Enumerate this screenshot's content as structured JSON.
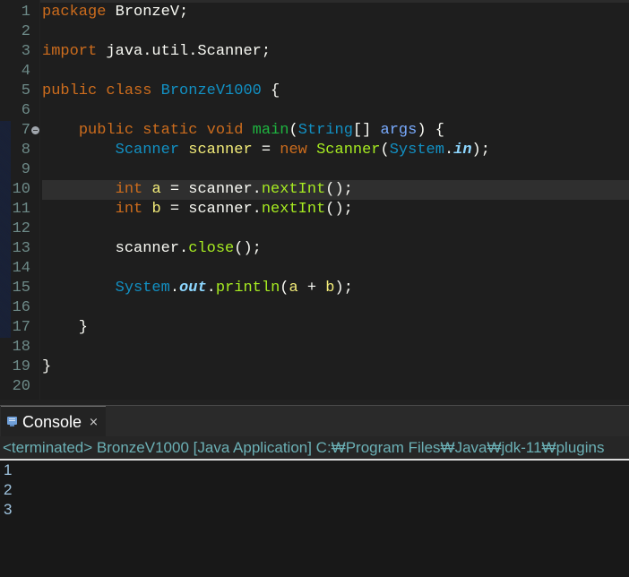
{
  "editor": {
    "current_line": 10,
    "lines": [
      {
        "n": "1",
        "tokens": [
          {
            "t": "package",
            "c": "kw"
          },
          {
            "t": " BronzeV;",
            "c": "punc"
          }
        ]
      },
      {
        "n": "2",
        "tokens": []
      },
      {
        "n": "3",
        "tokens": [
          {
            "t": "import",
            "c": "kw"
          },
          {
            "t": " java.util.Scanner;",
            "c": "punc"
          }
        ]
      },
      {
        "n": "4",
        "tokens": []
      },
      {
        "n": "5",
        "tokens": [
          {
            "t": "public",
            "c": "kw"
          },
          {
            "t": " ",
            "c": "punc"
          },
          {
            "t": "class",
            "c": "kw"
          },
          {
            "t": " ",
            "c": "punc"
          },
          {
            "t": "BronzeV1000",
            "c": "cls"
          },
          {
            "t": " {",
            "c": "punc"
          }
        ]
      },
      {
        "n": "6",
        "tokens": []
      },
      {
        "n": "7",
        "fold": true,
        "tokens": [
          {
            "t": "    ",
            "c": "punc"
          },
          {
            "t": "public",
            "c": "kw"
          },
          {
            "t": " ",
            "c": "punc"
          },
          {
            "t": "static",
            "c": "kw"
          },
          {
            "t": " ",
            "c": "punc"
          },
          {
            "t": "void",
            "c": "kw"
          },
          {
            "t": " ",
            "c": "punc"
          },
          {
            "t": "main",
            "c": "mdecl"
          },
          {
            "t": "(",
            "c": "punc"
          },
          {
            "t": "String",
            "c": "cls"
          },
          {
            "t": "[] ",
            "c": "punc"
          },
          {
            "t": "args",
            "c": "param"
          },
          {
            "t": ") {",
            "c": "punc"
          }
        ]
      },
      {
        "n": "8",
        "tokens": [
          {
            "t": "        ",
            "c": "punc"
          },
          {
            "t": "Scanner",
            "c": "cls"
          },
          {
            "t": " ",
            "c": "punc"
          },
          {
            "t": "scanner",
            "c": "var"
          },
          {
            "t": " = ",
            "c": "punc"
          },
          {
            "t": "new",
            "c": "kw"
          },
          {
            "t": " ",
            "c": "punc"
          },
          {
            "t": "Scanner",
            "c": "mcall"
          },
          {
            "t": "(",
            "c": "punc"
          },
          {
            "t": "System",
            "c": "cls"
          },
          {
            "t": ".",
            "c": "punc"
          },
          {
            "t": "in",
            "c": "static"
          },
          {
            "t": ");",
            "c": "punc"
          }
        ]
      },
      {
        "n": "9",
        "tokens": []
      },
      {
        "n": "10",
        "tokens": [
          {
            "t": "        ",
            "c": "punc"
          },
          {
            "t": "int",
            "c": "kw"
          },
          {
            "t": " ",
            "c": "punc"
          },
          {
            "t": "a",
            "c": "var"
          },
          {
            "t": " = scanner.",
            "c": "punc"
          },
          {
            "t": "nextInt",
            "c": "mcall"
          },
          {
            "t": "();",
            "c": "punc"
          }
        ]
      },
      {
        "n": "11",
        "tokens": [
          {
            "t": "        ",
            "c": "punc"
          },
          {
            "t": "int",
            "c": "kw"
          },
          {
            "t": " ",
            "c": "punc"
          },
          {
            "t": "b",
            "c": "var"
          },
          {
            "t": " = scanner.",
            "c": "punc"
          },
          {
            "t": "nextInt",
            "c": "mcall"
          },
          {
            "t": "();",
            "c": "punc"
          }
        ]
      },
      {
        "n": "12",
        "tokens": []
      },
      {
        "n": "13",
        "tokens": [
          {
            "t": "        scanner.",
            "c": "punc"
          },
          {
            "t": "close",
            "c": "mcall"
          },
          {
            "t": "();",
            "c": "punc"
          }
        ]
      },
      {
        "n": "14",
        "tokens": []
      },
      {
        "n": "15",
        "tokens": [
          {
            "t": "        ",
            "c": "punc"
          },
          {
            "t": "System",
            "c": "cls"
          },
          {
            "t": ".",
            "c": "punc"
          },
          {
            "t": "out",
            "c": "static"
          },
          {
            "t": ".",
            "c": "punc"
          },
          {
            "t": "println",
            "c": "mcall"
          },
          {
            "t": "(",
            "c": "punc"
          },
          {
            "t": "a",
            "c": "var"
          },
          {
            "t": " + ",
            "c": "punc"
          },
          {
            "t": "b",
            "c": "var"
          },
          {
            "t": ");",
            "c": "punc"
          }
        ]
      },
      {
        "n": "16",
        "tokens": []
      },
      {
        "n": "17",
        "tokens": [
          {
            "t": "    }",
            "c": "punc"
          }
        ]
      },
      {
        "n": "18",
        "tokens": []
      },
      {
        "n": "19",
        "tokens": [
          {
            "t": "}",
            "c": "punc"
          }
        ]
      },
      {
        "n": "20",
        "tokens": []
      }
    ]
  },
  "console": {
    "tab_label": "Console",
    "tab_icon": "console-icon",
    "close_icon": "close-icon",
    "close_glyph": "×",
    "header": "<terminated> BronzeV1000 [Java Application] C:₩Program Files₩Java₩jdk-11₩plugins",
    "output": [
      "1",
      "2",
      "3"
    ]
  }
}
